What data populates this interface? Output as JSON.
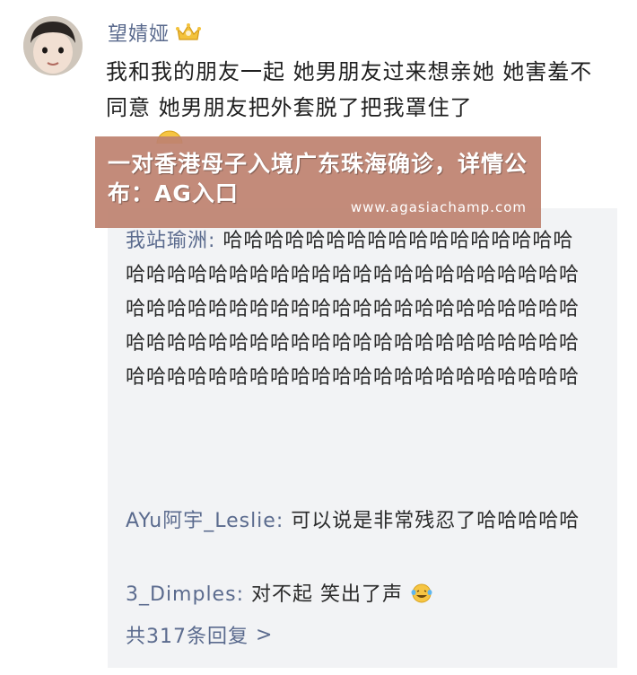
{
  "post": {
    "username": "望婧娅",
    "username_badge_icon": "crown-icon",
    "comment_text": "我和我的朋友一起 她男朋友过来想亲她 她害羞不同意 她男朋友把外套脱了把我罩住了"
  },
  "overlay": {
    "title": "一对香港母子入境广东珠海确诊，详情公布：AG入口",
    "url": "www.agasiachamp.com"
  },
  "replies": [
    {
      "author": "我站瑜洲",
      "separator": ": ",
      "text": "哈哈哈哈哈哈哈哈哈哈哈哈哈哈哈哈哈哈哈哈哈哈哈哈哈哈哈哈哈哈哈哈哈哈哈哈哈哈哈哈哈哈哈哈哈哈哈哈哈哈哈哈哈哈哈哈哈哈哈哈哈哈哈哈哈哈哈哈哈哈哈哈哈哈哈哈哈哈哈哈哈哈哈哈哈哈哈哈哈哈哈哈哈哈哈哈哈哈哈哈哈哈哈哈哈"
    },
    {
      "author": "AYu阿宇_Leslie",
      "separator": ": ",
      "text": "可以说是非常残忍了哈哈哈哈哈"
    },
    {
      "author": "3_Dimples",
      "separator": ": ",
      "text": "对不起 笑出了声"
    }
  ],
  "more_replies": {
    "label": "共317条回复",
    "chevron": ">"
  },
  "colors": {
    "name_blue": "#5b6b8e",
    "reply_bg": "#f2f3f5",
    "overlay_bg": "#be8270"
  }
}
